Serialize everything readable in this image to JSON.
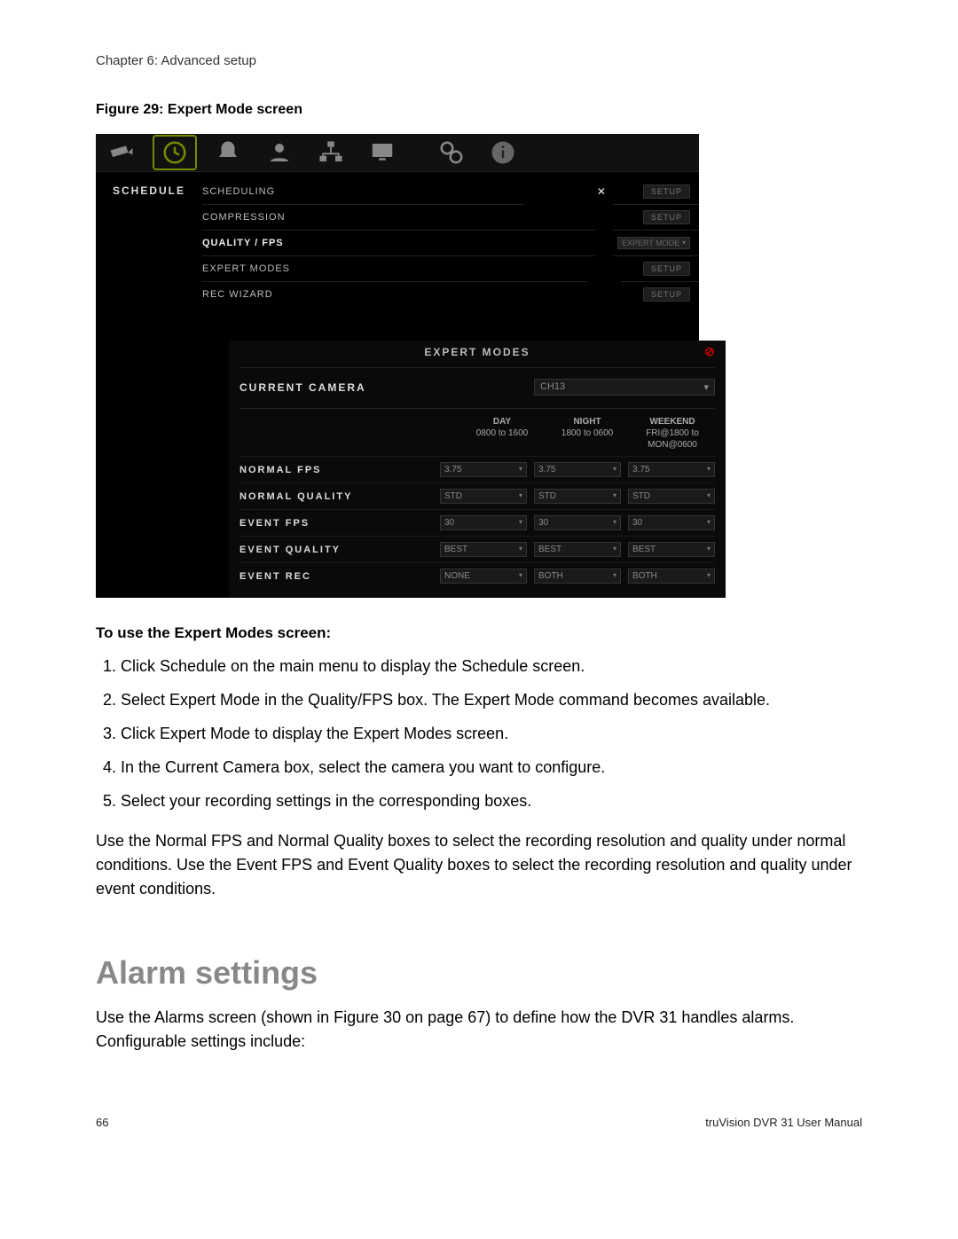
{
  "chapter": "Chapter 6: Advanced setup",
  "figure_caption": "Figure 29: Expert Mode screen",
  "dvr": {
    "side_label": "SCHEDULE",
    "rows": {
      "scheduling": {
        "label": "SCHEDULING",
        "setup": "SETUP"
      },
      "compression": {
        "label": "COMPRESSION",
        "setup": "SETUP"
      },
      "quality": {
        "label": "QUALITY / FPS",
        "mode": "EXPERT MODE"
      },
      "expert": {
        "label": "EXPERT MODES",
        "setup": "SETUP"
      },
      "wizard": {
        "label": "REC WIZARD",
        "setup": "SETUP"
      }
    }
  },
  "modal": {
    "title": "EXPERT MODES",
    "camera_label": "CURRENT CAMERA",
    "camera_value": "CH13",
    "cols": {
      "day": {
        "title": "DAY",
        "range": "0800 to 1600"
      },
      "night": {
        "title": "NIGHT",
        "range": "1800 to 0600"
      },
      "weekend": {
        "title": "WEEKEND",
        "range": "FRI@1800 to MON@0600"
      }
    },
    "rows": [
      {
        "label": "NORMAL FPS",
        "day": "3.75",
        "night": "3.75",
        "weekend": "3.75"
      },
      {
        "label": "NORMAL QUALITY",
        "day": "STD",
        "night": "STD",
        "weekend": "STD"
      },
      {
        "label": "EVENT FPS",
        "day": "30",
        "night": "30",
        "weekend": "30"
      },
      {
        "label": "EVENT QUALITY",
        "day": "BEST",
        "night": "BEST",
        "weekend": "BEST"
      },
      {
        "label": "EVENT REC",
        "day": "NONE",
        "night": "BOTH",
        "weekend": "BOTH"
      }
    ]
  },
  "instructions": {
    "heading": "To use the Expert Modes screen:",
    "steps": [
      "Click Schedule on the main menu to display the Schedule screen.",
      "Select Expert Mode in the Quality/FPS box. The Expert Mode command becomes available.",
      "Click Expert Mode to display the Expert Modes screen.",
      "In the Current Camera box, select the camera you want to configure.",
      "Select your recording settings in the corresponding boxes."
    ],
    "para": "Use the Normal FPS and Normal Quality boxes to select the recording resolution and quality under normal conditions. Use the Event FPS and Event Quality boxes to select the recording resolution and quality under event conditions."
  },
  "alarm": {
    "heading": "Alarm settings",
    "para": "Use the Alarms screen (shown in Figure 30 on page 67) to define how the DVR 31 handles alarms. Configurable settings include:"
  },
  "footer": {
    "page": "66",
    "manual": "truVision DVR 31 User Manual"
  }
}
